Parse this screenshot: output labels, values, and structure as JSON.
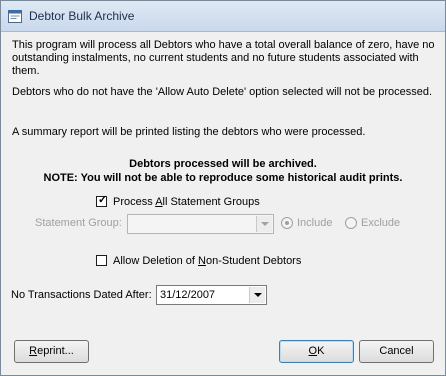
{
  "window": {
    "title": "Debtor Bulk Archive"
  },
  "description": {
    "paragraph1": "This program will process all Debtors who have a total overall balance of zero, have no outstanding instalments, no current students and no future students associated with them.",
    "paragraph2": "Debtors who do not have the 'Allow Auto Delete' option selected will not be processed.",
    "paragraph3": "A summary report will be printed listing the debtors who were processed."
  },
  "notice": {
    "line1": "Debtors processed will be archived.",
    "line2": "NOTE: You will not be able to reproduce some historical audit prints."
  },
  "process_all": {
    "label_pre": "Process ",
    "label_ul": "A",
    "label_post": "ll Statement Groups",
    "checked": true
  },
  "statement_group": {
    "label": "Statement Group:",
    "value": "",
    "include_label": "Include",
    "exclude_label": "Exclude",
    "include_selected": true
  },
  "allow_deletion": {
    "label_pre": "Allow Deletion of ",
    "label_ul": "N",
    "label_post": "on-Student Debtors",
    "checked": false
  },
  "no_transactions": {
    "label": "No Transactions Dated After:",
    "value": "31/12/2007"
  },
  "buttons": {
    "reprint": {
      "ul": "R",
      "rest": "eprint..."
    },
    "ok": {
      "ul": "O",
      "rest": "K"
    },
    "cancel": {
      "label": "Cancel"
    }
  }
}
